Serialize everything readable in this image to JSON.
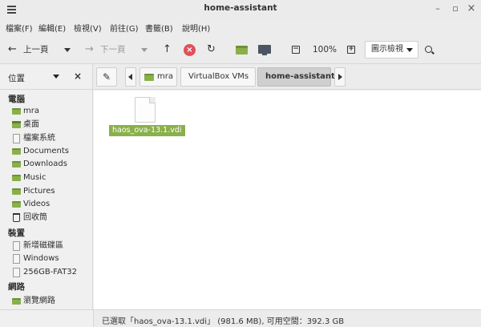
{
  "window": {
    "title": "home-assistant"
  },
  "menu": [
    "檔案(F)",
    "編輯(E)",
    "檢視(V)",
    "前往(G)",
    "書籤(B)",
    "說明(H)"
  ],
  "toolbar": {
    "back_label": "上一頁",
    "forward_label": "下一頁",
    "zoom_level": "100%",
    "view_mode": "圖示檢視"
  },
  "sidebar": {
    "header": "位置",
    "sections": [
      {
        "title": "電腦",
        "items": [
          {
            "label": "mra",
            "icon": "folder-icon"
          },
          {
            "label": "桌面",
            "icon": "desktop-icon"
          },
          {
            "label": "檔案系統",
            "icon": "drive-icon"
          },
          {
            "label": "Documents",
            "icon": "folder-icon"
          },
          {
            "label": "Downloads",
            "icon": "folder-icon"
          },
          {
            "label": "Music",
            "icon": "folder-icon"
          },
          {
            "label": "Pictures",
            "icon": "folder-icon"
          },
          {
            "label": "Videos",
            "icon": "folder-icon"
          },
          {
            "label": "回收筒",
            "icon": "trash-icon"
          }
        ]
      },
      {
        "title": "裝置",
        "items": [
          {
            "label": "新增磁碟區",
            "icon": "drive-icon"
          },
          {
            "label": "Windows",
            "icon": "drive-icon"
          },
          {
            "label": "256GB-FAT32",
            "icon": "drive-icon"
          }
        ]
      },
      {
        "title": "網路",
        "items": [
          {
            "label": "瀏覽網路",
            "icon": "network-icon"
          }
        ]
      }
    ]
  },
  "pathbar": {
    "crumbs": [
      "mra",
      "VirtualBox VMs",
      "home-assistant"
    ]
  },
  "files": [
    {
      "name": "haos_ova-13.1.vdi",
      "selected": true
    }
  ],
  "status": "已選取「haos_ova-13.1.vdi」 (981.6 MB), 可用空間：392.3 GB",
  "colors": {
    "accent": "#8ab04a",
    "stop": "#e0505a"
  }
}
